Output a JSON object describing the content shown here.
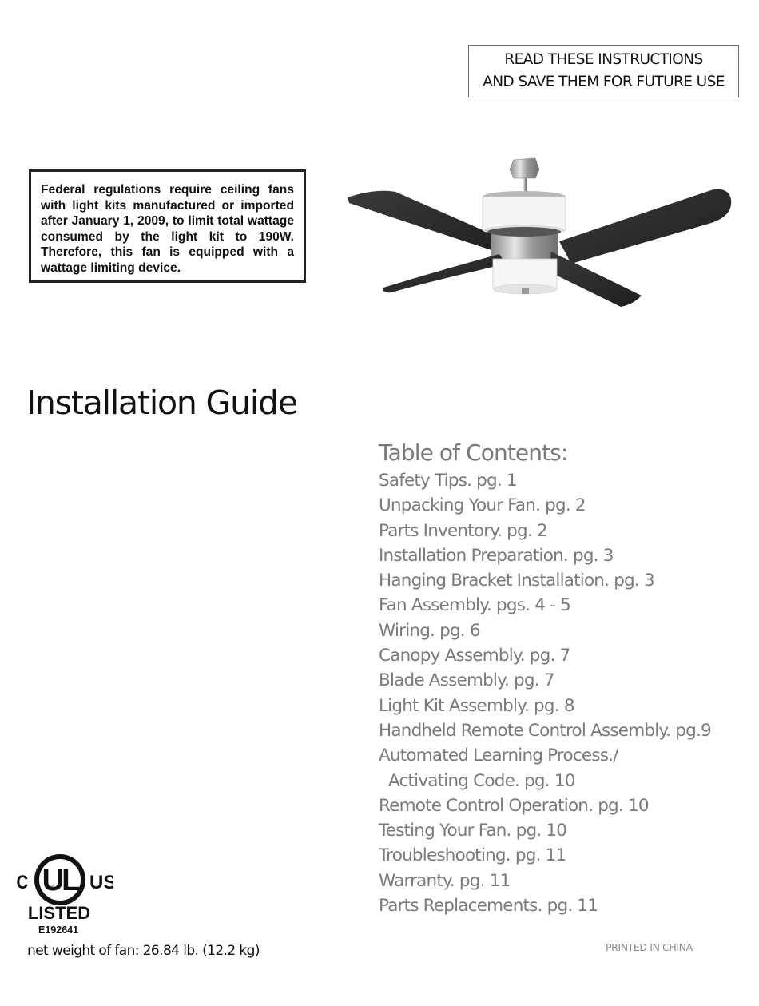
{
  "notice": {
    "line1": "READ THESE INSTRUCTIONS",
    "line2": "AND SAVE THEM FOR FUTURE USE"
  },
  "federal_notice": "Federal regulations require ceiling fans with light kits manufactured or imported after January 1, 2009, to limit total wattage consumed by the light kit to 190W.  Therefore, this fan is equipped with a wattage limiting device.",
  "product_image": {
    "alt": "ceiling-fan-with-light-kit",
    "blade_color": "#2b2b2b",
    "housing_color": "#c0c0c0"
  },
  "title": "Installation Guide",
  "toc": {
    "heading": "Table of Contents:",
    "items": [
      {
        "label": "Safety Tips. pg. 1"
      },
      {
        "label": "Unpacking Your Fan. pg. 2"
      },
      {
        "label": "Parts Inventory. pg. 2"
      },
      {
        "label": "Installation Preparation. pg. 3"
      },
      {
        "label": "Hanging Bracket Installation. pg. 3"
      },
      {
        "label": "Fan Assembly. pgs. 4 - 5"
      },
      {
        "label": "Wiring. pg. 6"
      },
      {
        "label": "Canopy Assembly. pg. 7"
      },
      {
        "label": "Blade Assembly. pg. 7"
      },
      {
        "label": "Light Kit Assembly. pg. 8"
      },
      {
        "label": "Handheld Remote Control Assembly. pg.9"
      },
      {
        "label": "Automated Learning Process./"
      },
      {
        "label": "Activating Code. pg. 10"
      },
      {
        "label": "Remote Control Operation. pg. 10"
      },
      {
        "label": "Testing Your Fan. pg. 10"
      },
      {
        "label": "Troubleshooting. pg. 11"
      },
      {
        "label": "Warranty. pg. 11"
      },
      {
        "label": "Parts Replacements. pg. 11"
      }
    ]
  },
  "certification": {
    "left": "C",
    "mark": "UL",
    "registered": "®",
    "right": "US",
    "status": "LISTED",
    "number": "E192641"
  },
  "net_weight": "net weight of fan: 26.84 lb. (12.2 kg)",
  "printed_in": "PRINTED IN CHINA",
  "colors": {
    "toc_text": "#7a7a7a",
    "body_text": "#111111"
  }
}
